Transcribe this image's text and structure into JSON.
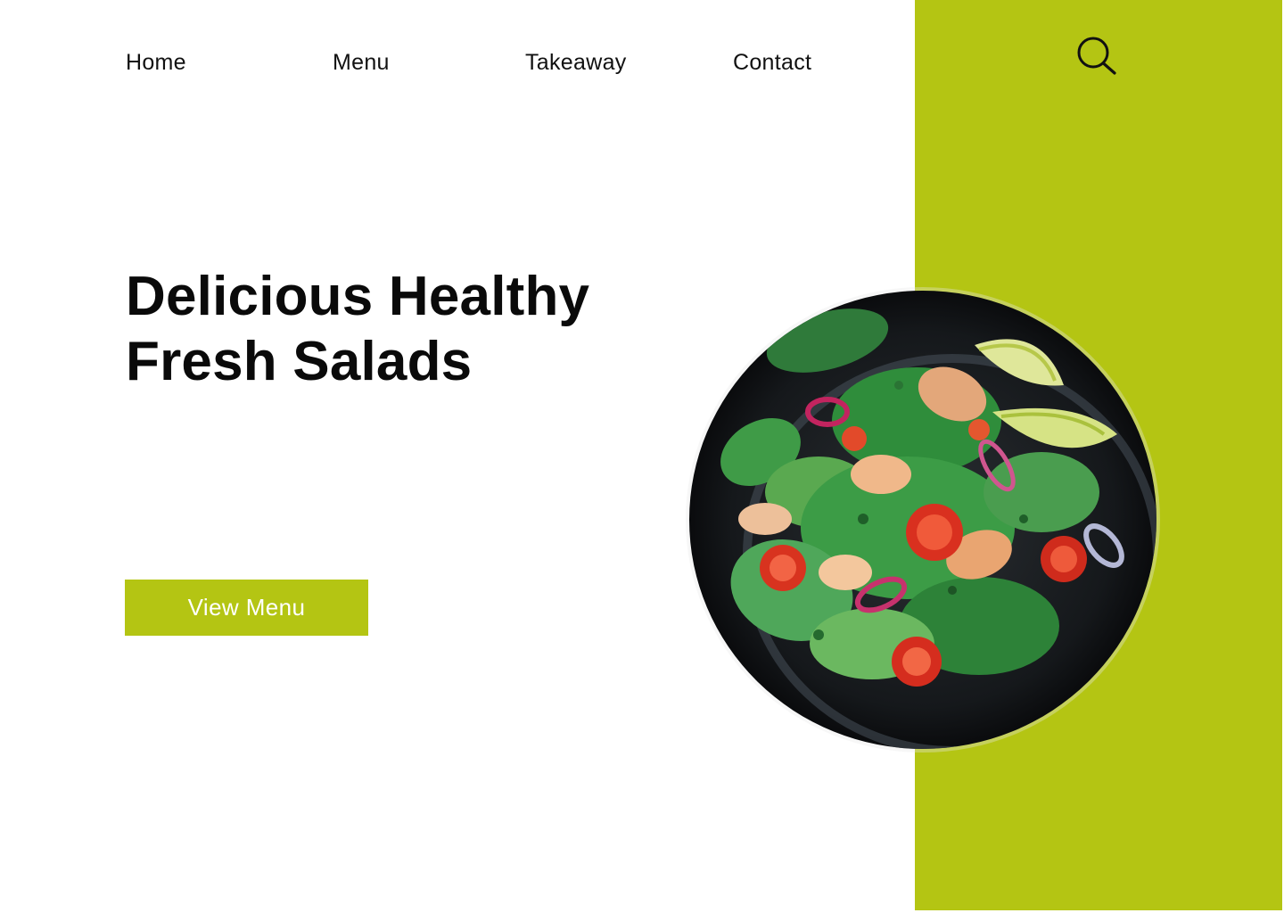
{
  "nav": {
    "items": [
      {
        "label": "Home"
      },
      {
        "label": "Menu"
      },
      {
        "label": "Takeaway"
      },
      {
        "label": "Contact"
      }
    ],
    "search_icon": "search-icon"
  },
  "hero": {
    "title_line1": "Delicious Healthy",
    "title_line2": "Fresh Salads",
    "button_label": "View Menu",
    "image_icon": "salad-bowl-image"
  },
  "colors": {
    "accent": "#b4c513",
    "text": "#0a0a0a",
    "background": "#ffffff",
    "button_text": "#ffffff"
  }
}
